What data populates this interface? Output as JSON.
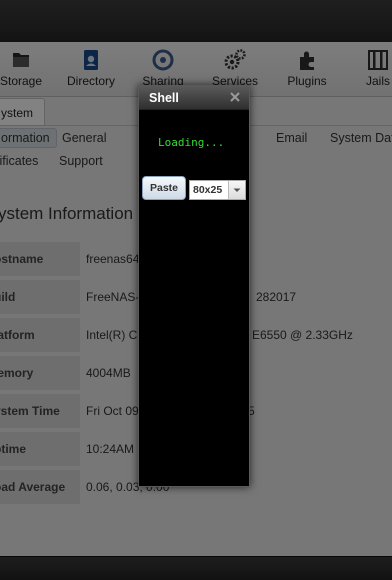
{
  "toolbar": {
    "items": [
      {
        "label": "Storage",
        "icon": "storage-icon"
      },
      {
        "label": "Directory",
        "icon": "directory-icon"
      },
      {
        "label": "Sharing",
        "icon": "sharing-icon"
      },
      {
        "label": "Services",
        "icon": "services-icon"
      },
      {
        "label": "Plugins",
        "icon": "plugins-icon"
      },
      {
        "label": "Jails",
        "icon": "jails-icon"
      }
    ]
  },
  "tabs": {
    "main": "ystem",
    "sub_row1": [
      "ormation",
      "General",
      "Email",
      "System Dat"
    ],
    "sub_row2": [
      "tificates",
      "Support"
    ]
  },
  "section": {
    "title": "ystem Information",
    "rows": [
      {
        "key": "ostname",
        "value": "freenas64"
      },
      {
        "key": "uild",
        "value": "FreeNAS-"
      },
      {
        "key": "latform",
        "value": "Intel(R) C"
      },
      {
        "key": "lemory",
        "value": "4004MB"
      },
      {
        "key": "ystem Time",
        "value": "Fri Oct 09"
      },
      {
        "key": "ptime",
        "value": "10:24AM"
      },
      {
        "key": "oad Average",
        "value": "0.06, 0.03, 0.00"
      }
    ],
    "visible_right_fragments": {
      "build": "282017",
      "platform": "E6550 @ 2.33GHz",
      "system_time": "5"
    }
  },
  "shell": {
    "title": "Shell",
    "loading_text": "Loading...",
    "paste_label": "Paste",
    "size_value": "80x25"
  }
}
